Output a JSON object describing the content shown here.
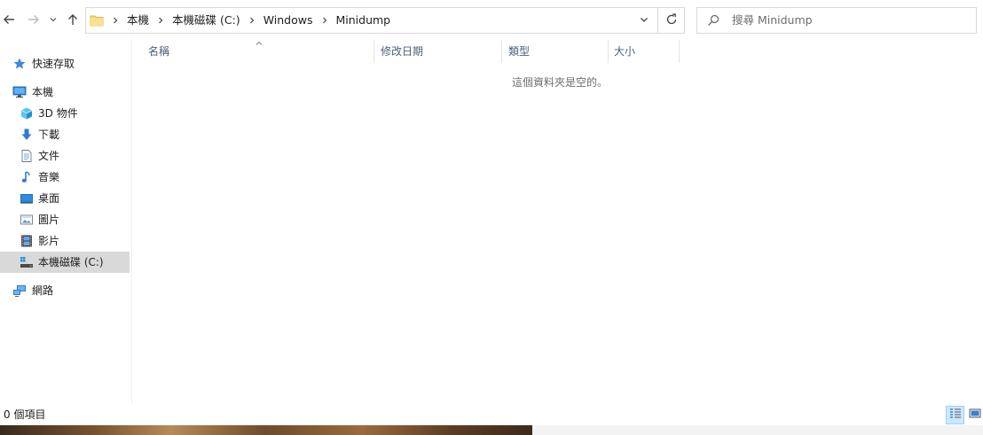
{
  "navigation": {
    "back_icon": "arrow-left-icon",
    "forward_icon": "arrow-right-icon",
    "recent_icon": "chevron-down-icon",
    "up_icon": "arrow-up-icon"
  },
  "address_bar": {
    "crumbs": [
      "本機",
      "本機磁碟 (C:)",
      "Windows",
      "Minidump"
    ],
    "folder_icon": "folder-icon",
    "dropdown_icon": "chevron-down-icon",
    "refresh_icon": "refresh-icon"
  },
  "search": {
    "placeholder": "搜尋 Minidump",
    "icon": "search-icon"
  },
  "sidebar": {
    "items": [
      {
        "label": "快速存取",
        "icon": "star-icon"
      },
      {
        "label": "本機",
        "icon": "computer-icon"
      },
      {
        "label": "3D 物件",
        "icon": "cube-icon"
      },
      {
        "label": "下載",
        "icon": "download-arrow-icon"
      },
      {
        "label": "文件",
        "icon": "document-icon"
      },
      {
        "label": "音樂",
        "icon": "music-note-icon"
      },
      {
        "label": "桌面",
        "icon": "desktop-icon"
      },
      {
        "label": "圖片",
        "icon": "picture-icon"
      },
      {
        "label": "影片",
        "icon": "film-icon"
      },
      {
        "label": "本機磁碟 (C:)",
        "icon": "drive-icon",
        "selected": true
      },
      {
        "label": "網路",
        "icon": "network-icon"
      }
    ]
  },
  "columns": [
    "名稱",
    "修改日期",
    "類型",
    "大小"
  ],
  "empty_message": "這個資料夾是空的。",
  "status": {
    "item_count": "0 個項目",
    "details_view_icon": "details-view-icon",
    "large_icons_view_icon": "large-icons-view-icon"
  },
  "colors": {
    "selection": "#d9d9d9",
    "header_text": "#4c607a",
    "accent": "#0078d7",
    "view_active": "#cce8ff"
  }
}
